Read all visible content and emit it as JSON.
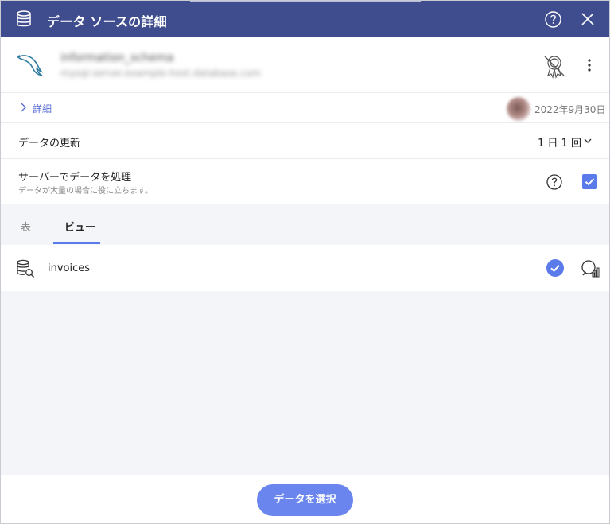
{
  "header": {
    "title": "データ ソースの詳細",
    "icons": [
      "database-icon",
      "help-icon",
      "close-icon"
    ],
    "bg_color": "#3f4d8f"
  },
  "source": {
    "name": "information_schema",
    "subtitle": "mysql-server.example-host.database.com",
    "logo": "mysql-dolphin-logo",
    "cert_icon": "certified-off-icon",
    "more_icon": "more-vertical-icon"
  },
  "details": {
    "label": "詳細",
    "date": "2022年9月30日"
  },
  "refresh": {
    "label": "データの更新",
    "value": "1 日 1 回"
  },
  "server_processing": {
    "label": "サーバーでデータを処理",
    "description": "データが大量の場合に役に立ちます。",
    "checked": true
  },
  "tabs": [
    {
      "label": "表",
      "active": false
    },
    {
      "label": "ビュー",
      "active": true
    }
  ],
  "list": {
    "items": [
      {
        "label": "invoices",
        "selected": true
      }
    ]
  },
  "footer": {
    "select_button": "データを選択"
  },
  "colors": {
    "accent": "#5b7bea",
    "button": "#6a86ee",
    "panel_bg": "#f4f5f8"
  }
}
